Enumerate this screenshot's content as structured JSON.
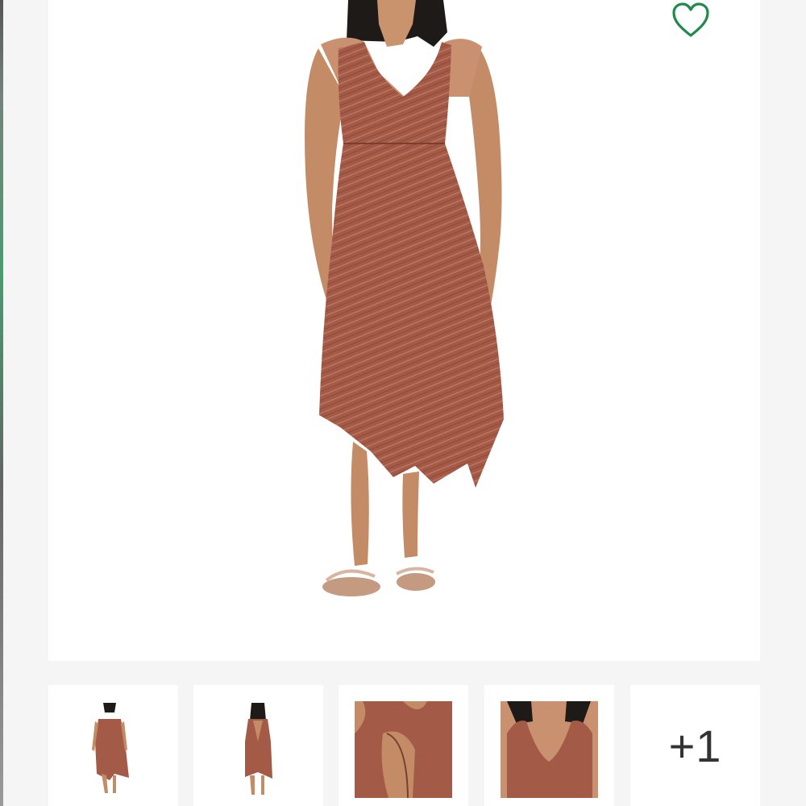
{
  "gallery": {
    "main_image": {
      "icon": "product-photo-dress-front"
    },
    "favorite": {
      "icon": "heart-outline-icon",
      "color": "#1e8a4c"
    },
    "thumbnails": [
      {
        "icon": "thumbnail-dress-front"
      },
      {
        "icon": "thumbnail-dress-back"
      },
      {
        "icon": "thumbnail-back-detail"
      },
      {
        "icon": "thumbnail-neckline-detail"
      }
    ],
    "more_count": "+1"
  },
  "colors": {
    "dress": "#a35a47",
    "background": "#f5f5f5",
    "card": "#ffffff",
    "accent": "#1e8a4c"
  }
}
